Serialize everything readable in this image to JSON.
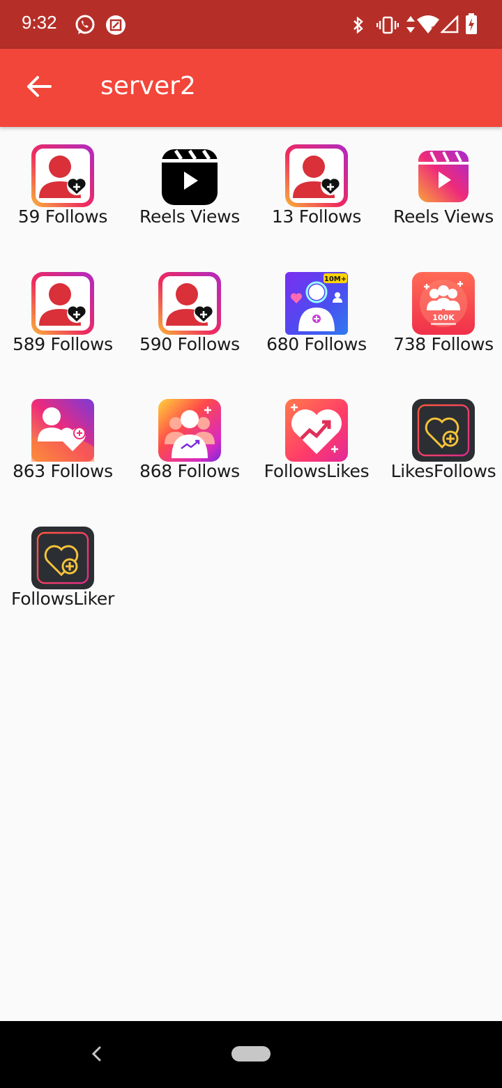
{
  "status_bar": {
    "time": "9:32"
  },
  "app_bar": {
    "title": "server2"
  },
  "tiles": [
    {
      "label": "59 Follows",
      "icon": "follows-heart-icon"
    },
    {
      "label": "Reels Views",
      "icon": "reels-black-icon"
    },
    {
      "label": "13 Follows",
      "icon": "follows-heart-icon"
    },
    {
      "label": "Reels Views",
      "icon": "reels-gradient-icon"
    },
    {
      "label": "589 Follows",
      "icon": "follows-heart-icon"
    },
    {
      "label": "590 Follows",
      "icon": "follows-heart-icon"
    },
    {
      "label": "680 Follows",
      "icon": "followers-10m-icon",
      "badge": "10M+"
    },
    {
      "label": "738 Follows",
      "icon": "followers-100k-icon",
      "badge": "100K"
    },
    {
      "label": "863 Follows",
      "icon": "user-heart-gradient-icon"
    },
    {
      "label": "868 Follows",
      "icon": "group-growth-icon"
    },
    {
      "label": "FollowsLikes",
      "icon": "heart-growth-icon"
    },
    {
      "label": "LikesFollows",
      "icon": "dark-heart-plus-icon"
    },
    {
      "label": "FollowsLiker",
      "icon": "dark-heart-plus-icon"
    }
  ]
}
